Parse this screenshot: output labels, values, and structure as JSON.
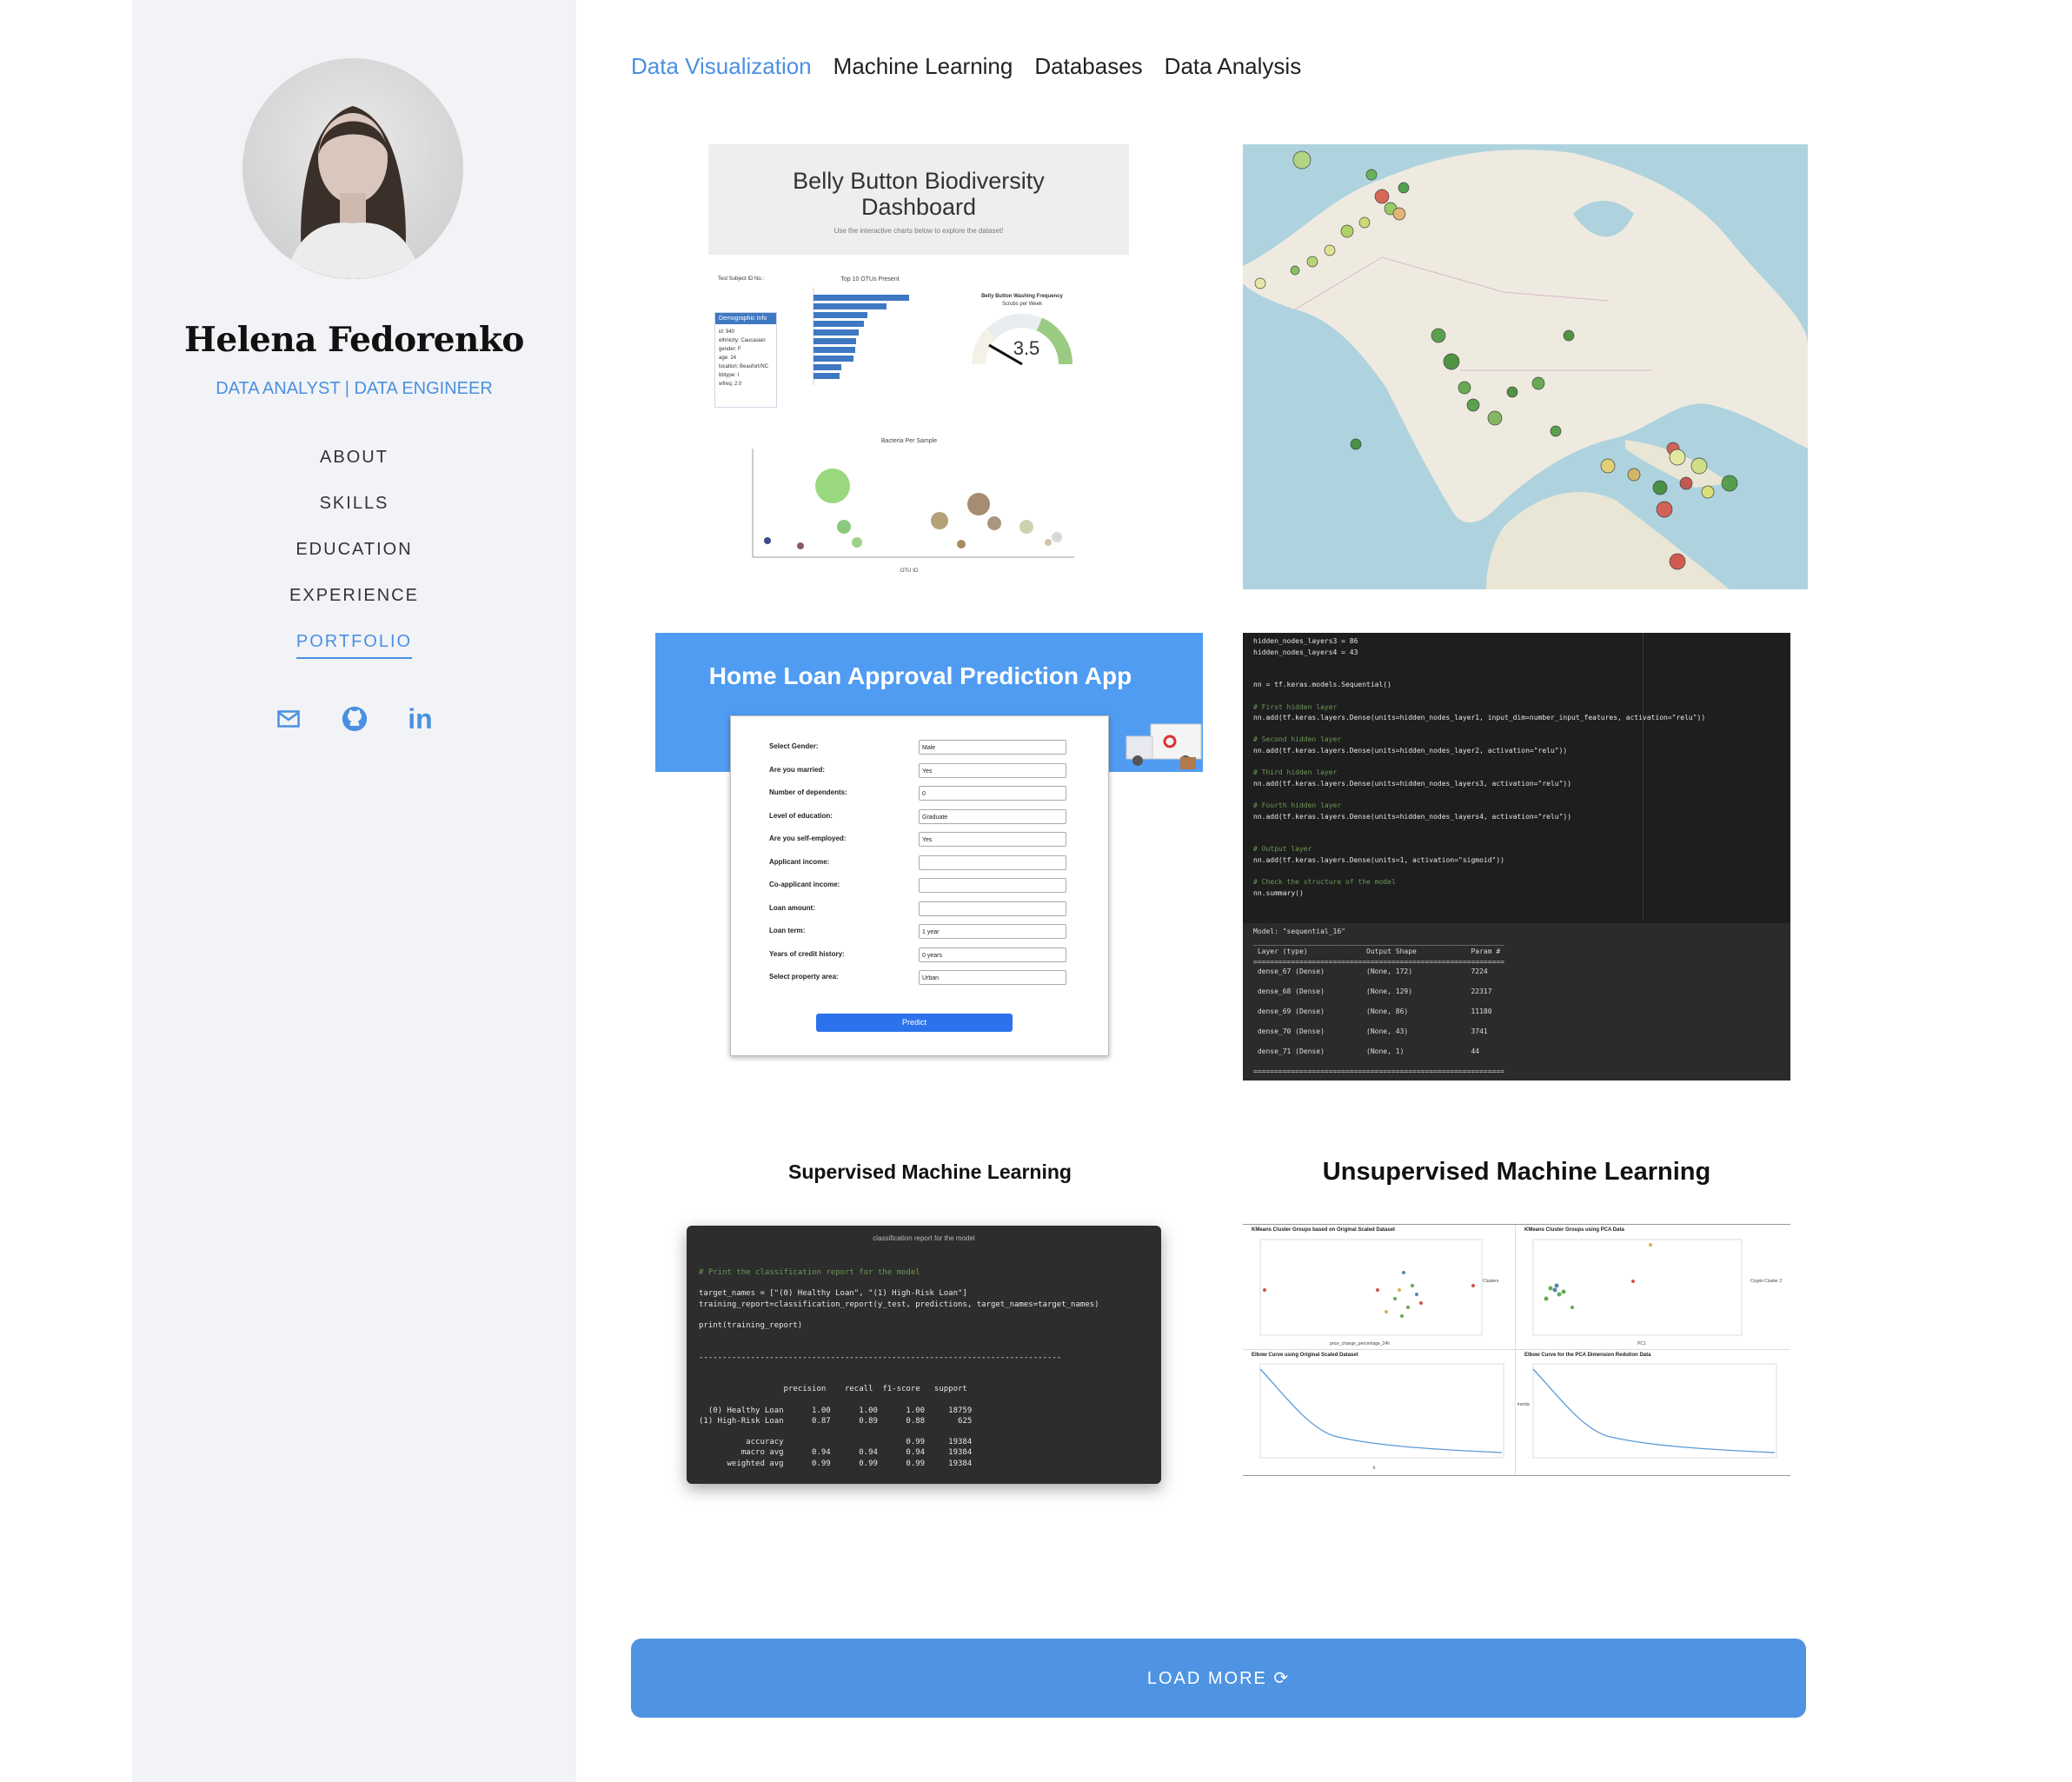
{
  "profile": {
    "name": "Helena Fedorenko",
    "role": "DATA ANALYST | DATA ENGINEER"
  },
  "nav": {
    "items": [
      {
        "label": "ABOUT"
      },
      {
        "label": "SKILLS"
      },
      {
        "label": "EDUCATION"
      },
      {
        "label": "EXPERIENCE"
      },
      {
        "label": "PORTFOLIO",
        "active": true
      }
    ]
  },
  "socials": {
    "icons": [
      "mail-icon",
      "github-icon",
      "linkedin-icon"
    ],
    "linkedin_text": "in"
  },
  "tabs": [
    {
      "label": "Data Visualization",
      "active": true
    },
    {
      "label": "Machine Learning"
    },
    {
      "label": "Databases"
    },
    {
      "label": "Data Analysis"
    }
  ],
  "projects": {
    "belly": {
      "title": "Belly Button Biodiversity Dashboard",
      "subtitle": "Use the interactive charts below to explore the dataset!",
      "test_subject": "Test Subject ID No.:",
      "demo_header": "Demographic Info",
      "demo_lines": [
        "id: 940",
        "ethnicity: Caucasian",
        "gender: F",
        "age: 24",
        "location: Beaufort/NC",
        "bbtype: I",
        "wfreq: 2.0"
      ],
      "bar_title": "Top 10 OTUs Present",
      "gauge_title": "Belly Button Washing Frequency",
      "gauge_subtitle": "Scrubs per Week",
      "gauge_value": "3.5",
      "bubble_title": "Bacteria Per Sample",
      "bubble_xlabel": "OTU ID"
    },
    "loan": {
      "title": "Home Loan Approval Prediction App",
      "fields": [
        {
          "label": "Select Gender:",
          "value": "Male"
        },
        {
          "label": "Are you married:",
          "value": "Yes"
        },
        {
          "label": "Number of dependents:",
          "value": "0"
        },
        {
          "label": "Level of education:",
          "value": "Graduate"
        },
        {
          "label": "Are you self-employed:",
          "value": "Yes"
        },
        {
          "label": "Applicant income:",
          "value": ""
        },
        {
          "label": "Co-applicant income:",
          "value": ""
        },
        {
          "label": "Loan amount:",
          "value": ""
        },
        {
          "label": "Loan term:",
          "value": "1 year"
        },
        {
          "label": "Years of credit history:",
          "value": "0 years"
        },
        {
          "label": "Select property area:",
          "value": "Urban"
        }
      ],
      "button": "Predict"
    },
    "nn_code": {
      "lines": [
        "hidden_nodes_layers3 = 86",
        "hidden_nodes_layers4 = 43",
        "",
        "",
        "nn = tf.keras.models.Sequential()",
        "",
        "# First hidden layer",
        "nn.add(tf.keras.layers.Dense(units=hidden_nodes_layer1, input_dim=number_input_features, activation=\"relu\"))",
        "",
        "# Second hidden layer",
        "nn.add(tf.keras.layers.Dense(units=hidden_nodes_layer2, activation=\"relu\"))",
        "",
        "# Third hidden layer",
        "nn.add(tf.keras.layers.Dense(units=hidden_nodes_layers3, activation=\"relu\"))",
        "",
        "# Fourth hidden layer",
        "nn.add(tf.keras.layers.Dense(units=hidden_nodes_layers4, activation=\"relu\"))",
        "",
        "",
        "# Output layer",
        "nn.add(tf.keras.layers.Dense(units=1, activation=\"sigmoid\"))",
        "",
        "# Check the structure of the model",
        "nn.summary()"
      ],
      "summary_lines": [
        "Model: \"sequential_16\"",
        "____________________________________________________________",
        " Layer (type)              Output Shape             Param #",
        "============================================================",
        " dense_67 (Dense)          (None, 172)              7224",
        "",
        " dense_68 (Dense)          (None, 129)              22317",
        "",
        " dense_69 (Dense)          (None, 86)               11180",
        "",
        " dense_70 (Dense)          (None, 43)               3741",
        "",
        " dense_71 (Dense)          (None, 1)                44",
        "",
        "============================================================"
      ]
    },
    "supervised": {
      "title": "Supervised Machine Learning",
      "window_title": "classification report for the model",
      "lines": [
        "# Print the classification report for the model",
        "",
        "target_names = [\"(0) Healthy Loan\", \"(1) High-Risk Loan\"]",
        "training_report=classification_report(y_test, predictions, target_names=target_names)",
        "",
        "print(training_report)",
        "",
        "",
        "-----------------------------------------------------------------------------",
        "",
        "",
        "                  precision    recall  f1-score   support",
        "",
        "  (0) Healthy Loan      1.00      1.00      1.00     18759",
        "(1) High-Risk Loan      0.87      0.89      0.88       625",
        "",
        "          accuracy                          0.99     19384",
        "         macro avg      0.94      0.94      0.94     19384",
        "      weighted avg      0.99      0.99      0.99     19384"
      ]
    },
    "unsupervised": {
      "title": "Unsupervised Machine Learning",
      "panels": [
        "KMeans Cluster Groups based on Original Scaled Dataset",
        "KMeans Cluster Groups using PCA Data",
        "Elbow Curve using Original Scaled Dataset",
        "Elbow Curve for the PCA Dimension Redution Data"
      ],
      "legend_titles": [
        "Clusters",
        "Crypto Cluster 2"
      ],
      "legend_items": [
        "0",
        "1",
        "2",
        "3"
      ],
      "axis_labels": [
        "price_change_percentage_24h",
        "PC1",
        "PC2",
        "k",
        "inertia"
      ]
    }
  },
  "load_more": {
    "label": "LOAD MORE ⟳"
  },
  "colors": {
    "accent": "#4a90e2",
    "sidebar": "#f2f3f6",
    "button": "#4f94e3"
  }
}
